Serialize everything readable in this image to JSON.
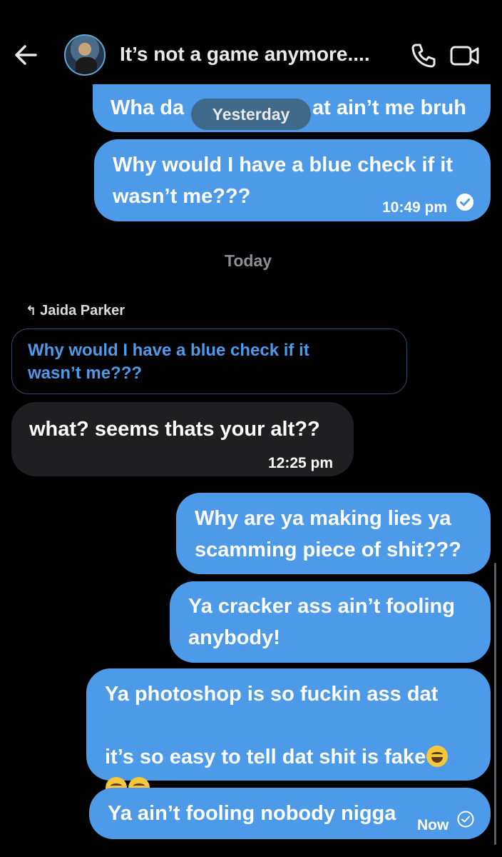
{
  "header": {
    "title": "It’s not a game anymore....",
    "back_icon": "back-arrow-icon",
    "call_icon": "phone-icon",
    "video_icon": "video-camera-icon"
  },
  "date_pill": "Yesterday",
  "messages_yesterday": [
    {
      "text": "Wha da ",
      "text_tail": "at ain’t me bruh"
    },
    {
      "text": "Why would I have a blue check if it\nwasn’t me???",
      "time": "10:49 pm",
      "status": "read"
    }
  ],
  "separator_today": "Today",
  "reply": {
    "label": "Jaida Parker",
    "quoted": "Why would I have a blue check if it\nwasn’t me???"
  },
  "received": {
    "text": "what? seems thats your alt??",
    "time": "12:25 pm"
  },
  "messages_today": [
    {
      "text": "Why are ya making lies ya\nscamming piece of shit???"
    },
    {
      "text": "Ya cracker ass ain’t fooling\nanybody!"
    },
    {
      "text_line1": "Ya photoshop is so fuckin ass dat",
      "text_line2": "it’s so easy to tell dat shit is fake"
    },
    {
      "text": "Ya ain’t fooling nobody nigga",
      "time": "Now",
      "status": "sent"
    }
  ],
  "colors": {
    "sent_bubble": "#4c9ae8",
    "received_bubble": "#1f1f22",
    "background": "#000000"
  }
}
